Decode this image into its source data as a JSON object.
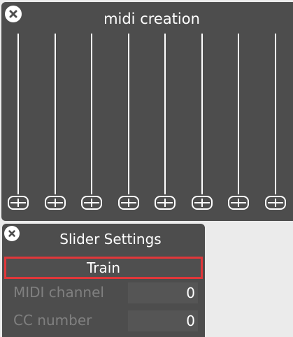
{
  "midi_panel": {
    "title": "midi creation",
    "slider_count": 8
  },
  "settings_panel": {
    "title": "Slider Settings",
    "train_label": "Train",
    "fields": [
      {
        "label": "MIDI channel",
        "value": "0"
      },
      {
        "label": "CC number",
        "value": "0"
      }
    ]
  },
  "colors": {
    "panel_bg": "#4d4d4d",
    "page_bg": "#ebebeb",
    "highlight": "#e0373a",
    "label_dim": "#808080"
  },
  "icons": {
    "close": "close-icon",
    "slider_handle": "slider-handle-icon"
  }
}
